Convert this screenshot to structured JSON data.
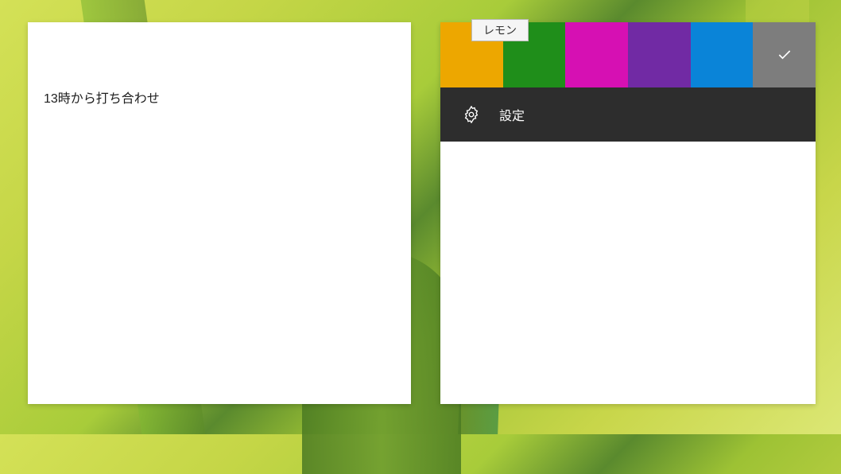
{
  "left_note": {
    "content": "13時から打ち合わせ"
  },
  "right_note": {
    "tooltip": "レモン",
    "colors": [
      {
        "name": "yellow-color",
        "hex": "#eda700",
        "selected": false
      },
      {
        "name": "green-color",
        "hex": "#1f8e1a",
        "selected": false
      },
      {
        "name": "magenta-color",
        "hex": "#d610b3",
        "selected": false
      },
      {
        "name": "purple-color",
        "hex": "#712aa4",
        "selected": false
      },
      {
        "name": "blue-color",
        "hex": "#0a84d8",
        "selected": false
      },
      {
        "name": "gray-color",
        "hex": "#7d7d7d",
        "selected": true
      }
    ],
    "settings_label": "設定"
  }
}
